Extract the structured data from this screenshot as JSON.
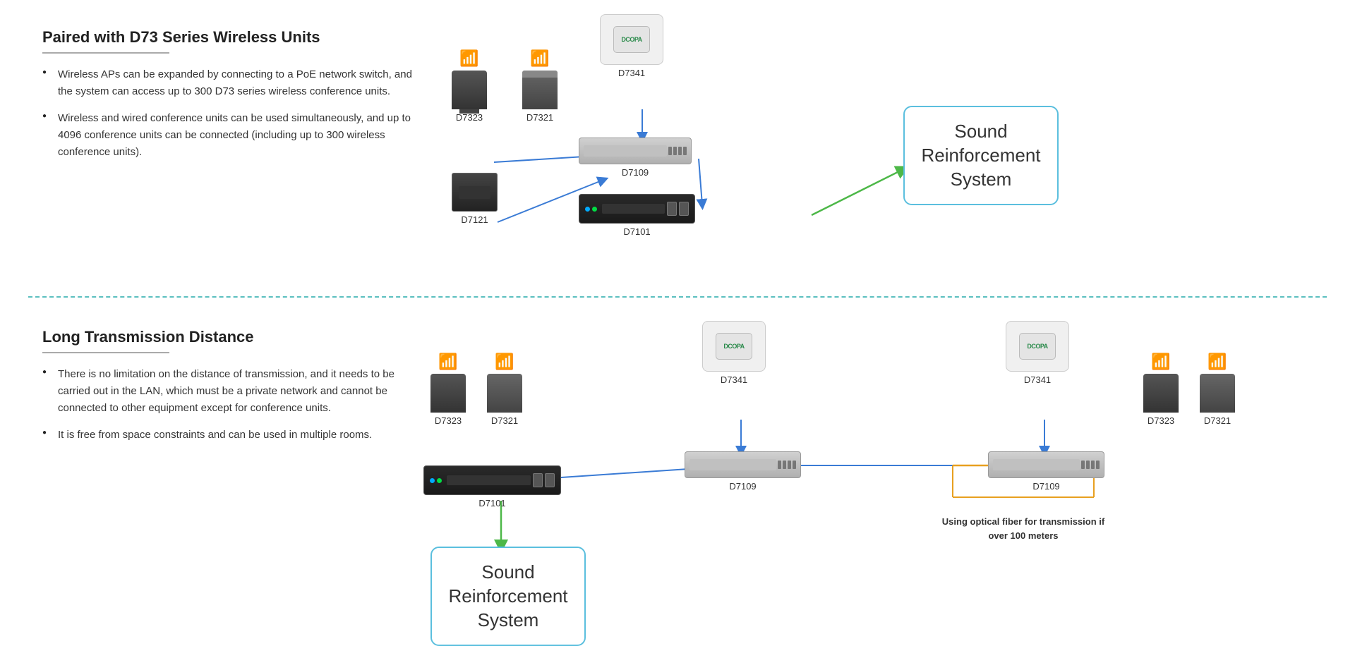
{
  "top_section": {
    "title": "Paired with D73 Series Wireless Units",
    "bullets": [
      "Wireless APs can be expanded by connecting to a PoE network switch, and the system can access up to 300 D73 series wireless conference units.",
      "Wireless and wired conference units can be used simultaneously, and up to 4096 conference units can be connected (including up to 300 wireless conference units)."
    ],
    "devices": {
      "d7323_label": "D7323",
      "d7321_label": "D7321",
      "d7341_label": "D7341",
      "d7109_label": "D7109",
      "d7121_label": "D7121",
      "d7101_label": "D7101"
    },
    "srs_box_text": "Sound\nReinforcement\nSystem"
  },
  "bottom_section": {
    "title": "Long Transmission Distance",
    "bullets": [
      "There is no limitation on the distance of transmission, and it needs to be carried out in the LAN, which must be a private network and cannot be connected to other equipment except for conference units.",
      "It is free from space constraints and can be used in multiple rooms."
    ],
    "devices": {
      "d7323_label": "D7323",
      "d7321_label": "D7321",
      "d7341_label_1": "D7341",
      "d7341_label_2": "D7341",
      "d7109_label_1": "D7109",
      "d7109_label_2": "D7109",
      "d7101_label": "D7101",
      "d7323_label_2": "D7323",
      "d7321_label_2": "D7321"
    },
    "srs_box_text": "Sound\nReinforcement\nSystem",
    "fiber_note": "Using optical fiber for transmission\nif over 100 meters"
  }
}
